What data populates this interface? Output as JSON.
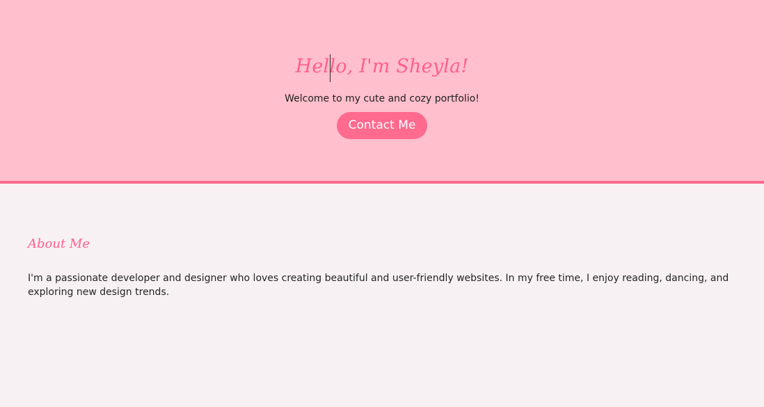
{
  "hero": {
    "title": "Hello, I'm Sheyla!",
    "subtitle": "Welcome to my cute and cozy portfolio!",
    "contact_button": "Contact Me"
  },
  "about": {
    "title": "About Me",
    "text": "I'm a passionate developer and designer who loves creating beautiful and user-friendly websites. In my free time, I enjoy reading, dancing, and exploring new design trends."
  },
  "colors": {
    "hero_background": "#ffbfcc",
    "accent": "#ff6a8f",
    "page_background": "#f7f1f3"
  }
}
